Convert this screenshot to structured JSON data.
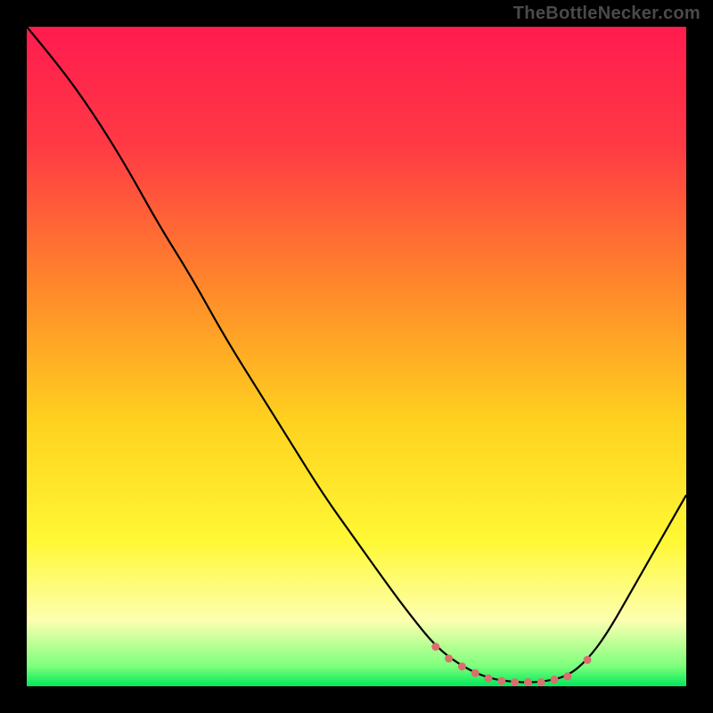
{
  "watermark": "TheBottleNecker.com",
  "chart_data": {
    "type": "line",
    "title": "",
    "xlabel": "",
    "ylabel": "",
    "xlim": [
      0,
      100
    ],
    "ylim": [
      0,
      100
    ],
    "background_gradient_stops": [
      {
        "offset": 0,
        "color": "#ff1b4f"
      },
      {
        "offset": 18,
        "color": "#ff3a44"
      },
      {
        "offset": 40,
        "color": "#ff8a2a"
      },
      {
        "offset": 60,
        "color": "#ffd21f"
      },
      {
        "offset": 78,
        "color": "#fff835"
      },
      {
        "offset": 90,
        "color": "#fdffb0"
      },
      {
        "offset": 97,
        "color": "#7cff7c"
      },
      {
        "offset": 100,
        "color": "#00e85a"
      }
    ],
    "curve": [
      {
        "x": 0,
        "y": 100
      },
      {
        "x": 5,
        "y": 94
      },
      {
        "x": 10,
        "y": 87
      },
      {
        "x": 15,
        "y": 79
      },
      {
        "x": 20,
        "y": 70
      },
      {
        "x": 25,
        "y": 62
      },
      {
        "x": 30,
        "y": 53
      },
      {
        "x": 35,
        "y": 45
      },
      {
        "x": 40,
        "y": 37
      },
      {
        "x": 45,
        "y": 29
      },
      {
        "x": 50,
        "y": 22
      },
      {
        "x": 55,
        "y": 15
      },
      {
        "x": 58,
        "y": 11
      },
      {
        "x": 62,
        "y": 6
      },
      {
        "x": 66,
        "y": 3
      },
      {
        "x": 70,
        "y": 1.2
      },
      {
        "x": 74,
        "y": 0.6
      },
      {
        "x": 78,
        "y": 0.6
      },
      {
        "x": 82,
        "y": 1.5
      },
      {
        "x": 85,
        "y": 4
      },
      {
        "x": 88,
        "y": 8
      },
      {
        "x": 92,
        "y": 15
      },
      {
        "x": 96,
        "y": 22
      },
      {
        "x": 100,
        "y": 29
      }
    ],
    "optimum_markers": [
      {
        "x": 62,
        "y": 6
      },
      {
        "x": 64,
        "y": 4.2
      },
      {
        "x": 66,
        "y": 3
      },
      {
        "x": 68,
        "y": 2
      },
      {
        "x": 70,
        "y": 1.2
      },
      {
        "x": 72,
        "y": 0.8
      },
      {
        "x": 74,
        "y": 0.6
      },
      {
        "x": 76,
        "y": 0.6
      },
      {
        "x": 78,
        "y": 0.6
      },
      {
        "x": 80,
        "y": 1
      },
      {
        "x": 82,
        "y": 1.5
      },
      {
        "x": 85,
        "y": 4
      }
    ],
    "marker_color": "#d9706d",
    "curve_color": "#000000"
  }
}
